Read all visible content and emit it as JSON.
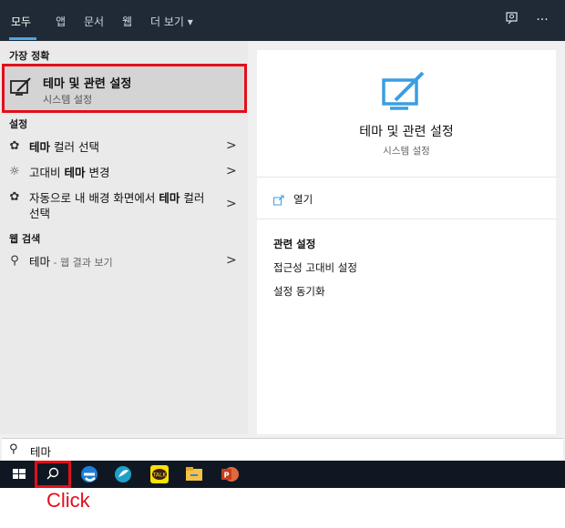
{
  "tabs": [
    "모두",
    "앱",
    "문서",
    "웹",
    "더 보기"
  ],
  "tab_more_arrow": "▾",
  "top_icons": [
    "feedback-icon",
    "more-icon"
  ],
  "left": {
    "best_match_header": "가장 정확",
    "best": {
      "title": "테마 및 관련 설정",
      "subtitle": "시스템 설정",
      "icon": "theme-paint-icon"
    },
    "settings_header": "설정",
    "settings": [
      {
        "bold": "테마",
        "rest": " 컬러 선택",
        "icon": "palette-icon"
      },
      {
        "pre": "고대비 ",
        "bold": "테마",
        "rest": " 변경",
        "icon": "brightness-icon"
      },
      {
        "pre": "자동으로 내 배경 화면에서 ",
        "bold": "테마",
        "rest": " 컬러 선택",
        "icon": "palette-icon"
      }
    ],
    "web_header": "웹 검색",
    "web": {
      "text": "테마",
      "suffix": " - 웹 결과 보기",
      "icon": "search-icon"
    }
  },
  "right": {
    "title": "테마 및 관련 설정",
    "subtitle": "시스템 설정",
    "open_label": "열기",
    "related_header": "관련 설정",
    "related": [
      "접근성 고대비 설정",
      "설정 동기화"
    ]
  },
  "search": {
    "value": "테마"
  },
  "taskbar": [
    "windows-start-icon",
    "search-icon",
    "edge-icon",
    "app-icon",
    "kakaotalk-icon",
    "file-explorer-icon",
    "powerpoint-icon"
  ],
  "annotation": "Click",
  "colors": {
    "accent": "#4ea5e6",
    "highlight": "#e20f1a",
    "taskbar": "#0f1822",
    "topbar": "#1f2a36"
  }
}
